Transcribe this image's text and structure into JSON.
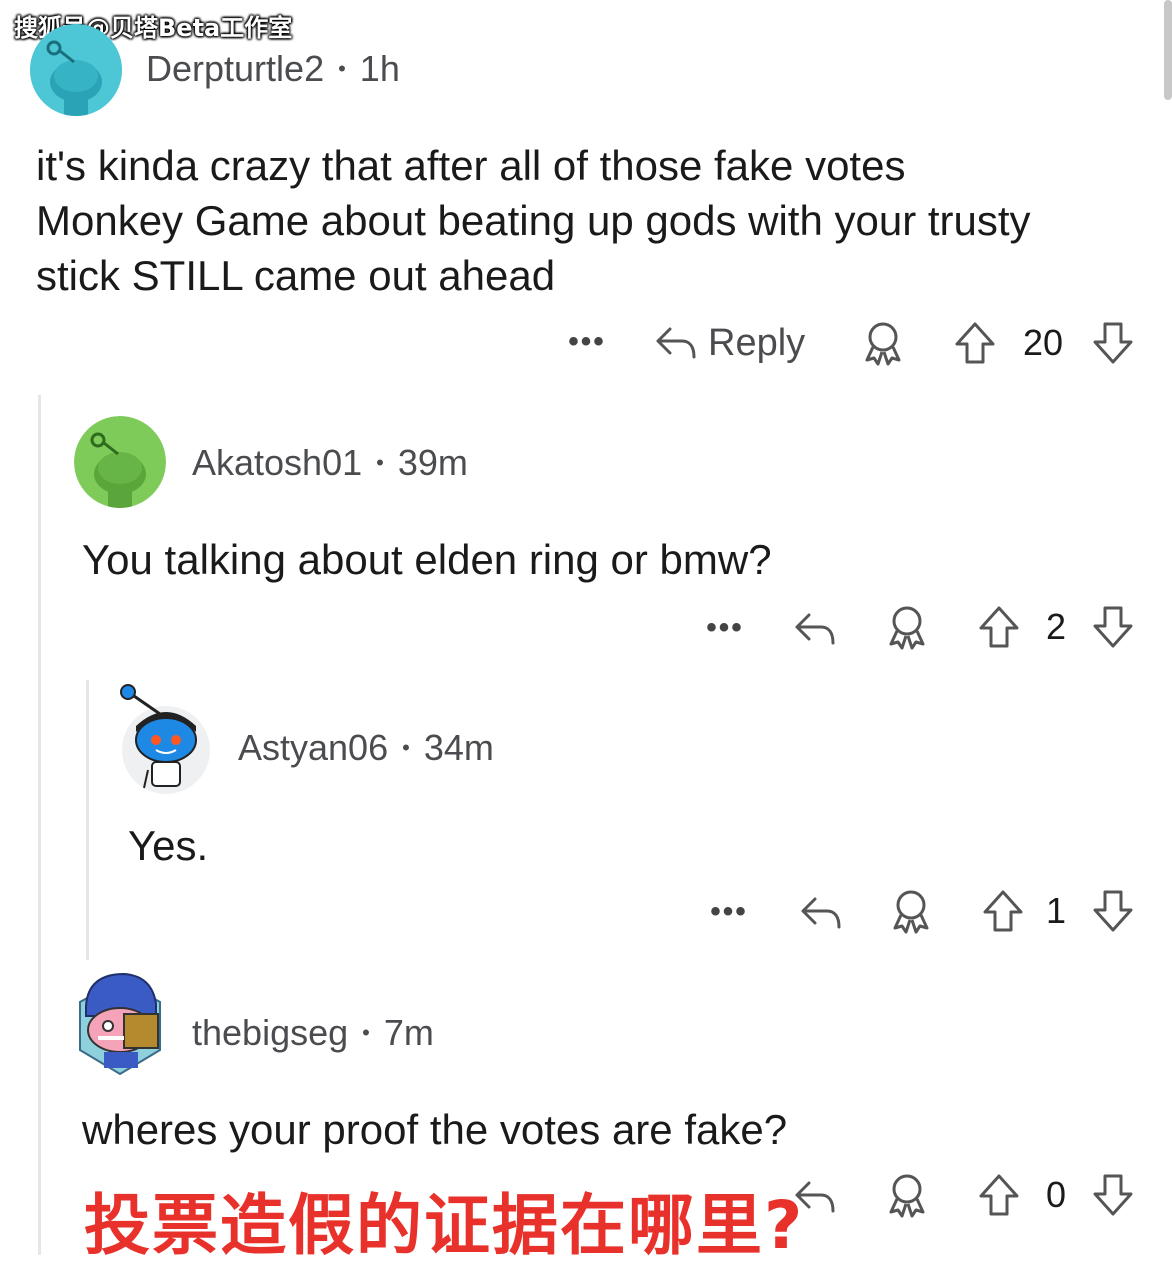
{
  "watermark": "搜狐号@贝塔Beta工作室",
  "overlay_caption": "投票造假的证据在哪里?",
  "comments": [
    {
      "author": "Derpturtle2",
      "age": "1h",
      "text": "it's kinda crazy that after all of those fake votes Monkey Game about beating up gods with your trusty stick STILL came out ahead",
      "reply_label": "Reply",
      "score": "20",
      "more": "•••",
      "avatar_color": "#4dc6d6"
    },
    {
      "author": "Akatosh01",
      "age": "39m",
      "text": "You talking about elden ring or bmw?",
      "score": "2",
      "more": "•••",
      "avatar_color": "#7ecb5a"
    },
    {
      "author": "Astyan06",
      "age": "34m",
      "text": "Yes.",
      "score": "1",
      "more": "•••",
      "avatar_color": "#1e88e5"
    },
    {
      "author": "thebigseg",
      "age": "7m",
      "text": "wheres your proof the votes are fake?",
      "score": "0",
      "avatar_color": "#3b5bc4"
    }
  ],
  "separator": "•",
  "icons": [
    "reply-arrow-icon",
    "award-icon",
    "upvote-icon",
    "downvote-icon",
    "more-options-icon"
  ]
}
